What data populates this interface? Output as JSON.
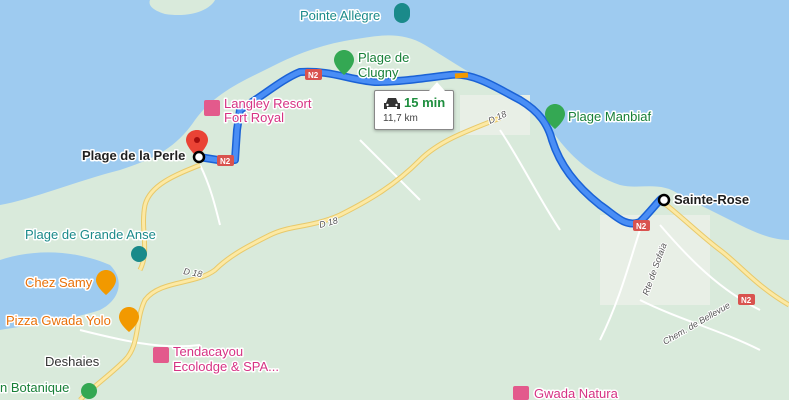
{
  "map": {
    "colors": {
      "water": "#9ecbf0",
      "land": "#d9eadb",
      "road_major": "#fce9a4",
      "route": "#4a8ef5",
      "route_outline": "#1a62d6",
      "traffic": "#f29900"
    },
    "route": {
      "time": "15 min",
      "distance": "11,7 km",
      "icon": "car-icon"
    },
    "places": {
      "origin": "Plage de la Perle",
      "destination": "Sainte-Rose",
      "town": "Deshaies"
    },
    "pois": {
      "pointe_allegre": "Pointe Allègre",
      "plage_clugny_l1": "Plage de",
      "plage_clugny_l2": "Clugny",
      "langley_l1": "Langley Resort",
      "langley_l2": "Fort Royal",
      "plage_manbiaf": "Plage Manbiaf",
      "plage_grande_anse": "Plage de Grande Anse",
      "chez_samy": "Chez Samy",
      "pizza": "Pizza Gwada Yolo",
      "tendacayou_l1": "Tendacayou",
      "tendacayou_l2": "Ecolodge & SPA...",
      "botanique": "n Botanique",
      "gwada_natura": "Gwada Natura"
    },
    "roads": {
      "n2": "N2",
      "d18": "D 18",
      "rte_sofaia": "Rte de Sofaïa",
      "chem_bellevue": "Chem. de Bellevue"
    }
  }
}
